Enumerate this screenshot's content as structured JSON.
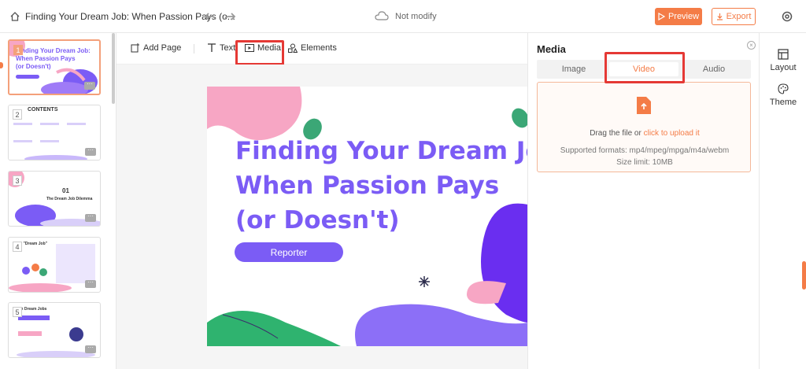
{
  "topbar": {
    "title": "Finding Your Dream Job: When Passion Pays (o...",
    "save_status": "Not modify",
    "preview_label": "Preview",
    "export_label": "Export"
  },
  "slides": [
    {
      "num": "1",
      "active": true
    },
    {
      "num": "2",
      "heading": "CONTENTS",
      "active": false
    },
    {
      "num": "3",
      "heading": "01",
      "sub": "The Dream Job Dilemma",
      "active": false
    },
    {
      "num": "4",
      "heading": "g \"Dream Job\"",
      "active": false
    },
    {
      "num": "5",
      "heading": "m Dream Jobs",
      "active": false
    }
  ],
  "toolbar": {
    "add_page": "Add Page",
    "text": "Text",
    "media": "Media",
    "elements": "Elements"
  },
  "slide_canvas": {
    "title_lines": [
      "Finding Your Dream Job",
      "When Passion Pays",
      "(or Doesn't)"
    ],
    "reporter": "Reporter"
  },
  "thumb1": {
    "title_lines": [
      "Finding Your Dream Job:",
      "When Passion Pays",
      "(or Doesn't)"
    ]
  },
  "media_panel": {
    "title": "Media",
    "tabs": [
      "Image",
      "Video",
      "Audio"
    ],
    "active_tab": "Video",
    "drag_text": "Drag the file or ",
    "upload_link": "click to upload it",
    "formats": "Supported formats: mp4/mpeg/mpga/m4a/webm",
    "size_limit": "Size limit: 10MB"
  },
  "right_rail": {
    "layout": "Layout",
    "theme": "Theme"
  },
  "colors": {
    "accent": "#f47c47",
    "brand_purple": "#7b5cf5",
    "highlight_red": "#e53935"
  }
}
